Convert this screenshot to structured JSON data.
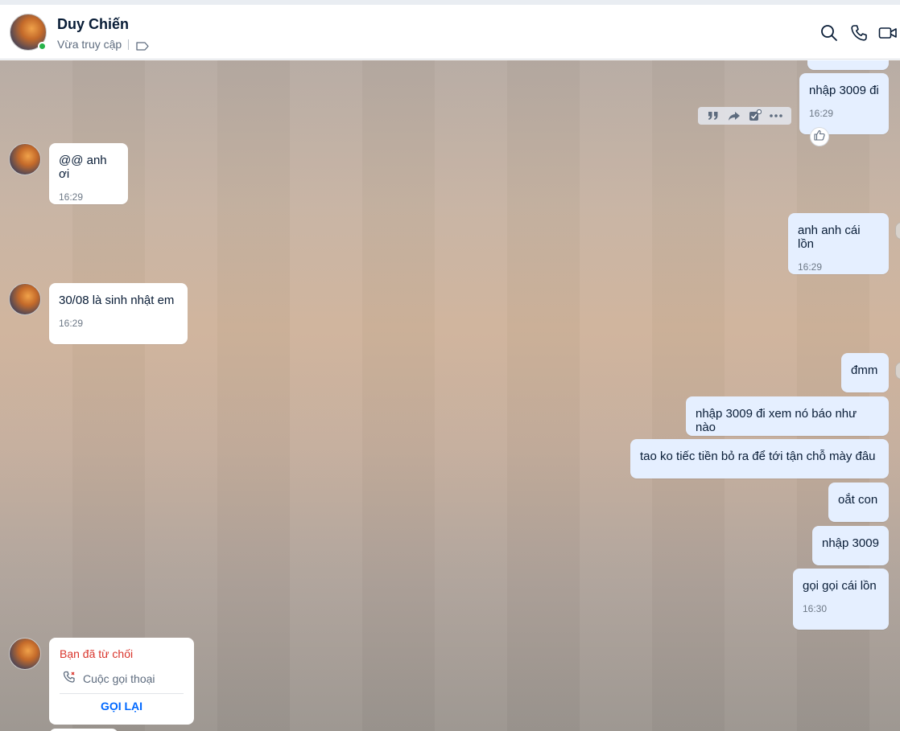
{
  "header": {
    "contact_name": "Duy Chiến",
    "status": "Vừa truy cập",
    "icons": [
      "search-icon",
      "phone-icon",
      "video-call-icon"
    ],
    "online": true
  },
  "colors": {
    "my_bubble": "#e5efff",
    "their_bubble": "#ffffff",
    "online": "#27b34a",
    "declined_call": "#d9342b",
    "action_blue": "#0068ff"
  },
  "messages": {
    "m1": {
      "text": "nhập 3009 đi",
      "time": "16:29",
      "sender": "me"
    },
    "m2": {
      "text": "@@ anh ơi",
      "time": "16:29",
      "sender": "them"
    },
    "m3": {
      "text": "anh anh cái lồn",
      "time": "16:29",
      "sender": "me"
    },
    "m4": {
      "text": "30/08 là sinh nhật em",
      "time": "16:29",
      "sender": "them"
    },
    "m5": {
      "text": "đmm",
      "sender": "me"
    },
    "m6": {
      "text": "nhập 3009 đi xem nó báo như nào",
      "sender": "me"
    },
    "m7": {
      "text": "tao ko tiếc tiền bỏ ra để tới tận chỗ mày đâu",
      "sender": "me"
    },
    "m8": {
      "text": "oắt con",
      "sender": "me"
    },
    "m9": {
      "text": "nhập 3009",
      "sender": "me"
    },
    "m10": {
      "text": "gọi gọi cái lồn",
      "time": "16:30",
      "sender": "me"
    }
  },
  "message_actions": [
    "quote-icon",
    "forward-icon",
    "add-task-icon",
    "more-icon"
  ],
  "call_card": {
    "title": "Bạn đã từ chối",
    "type": "Cuộc gọi thoại",
    "action": "GỌI LẠI"
  }
}
